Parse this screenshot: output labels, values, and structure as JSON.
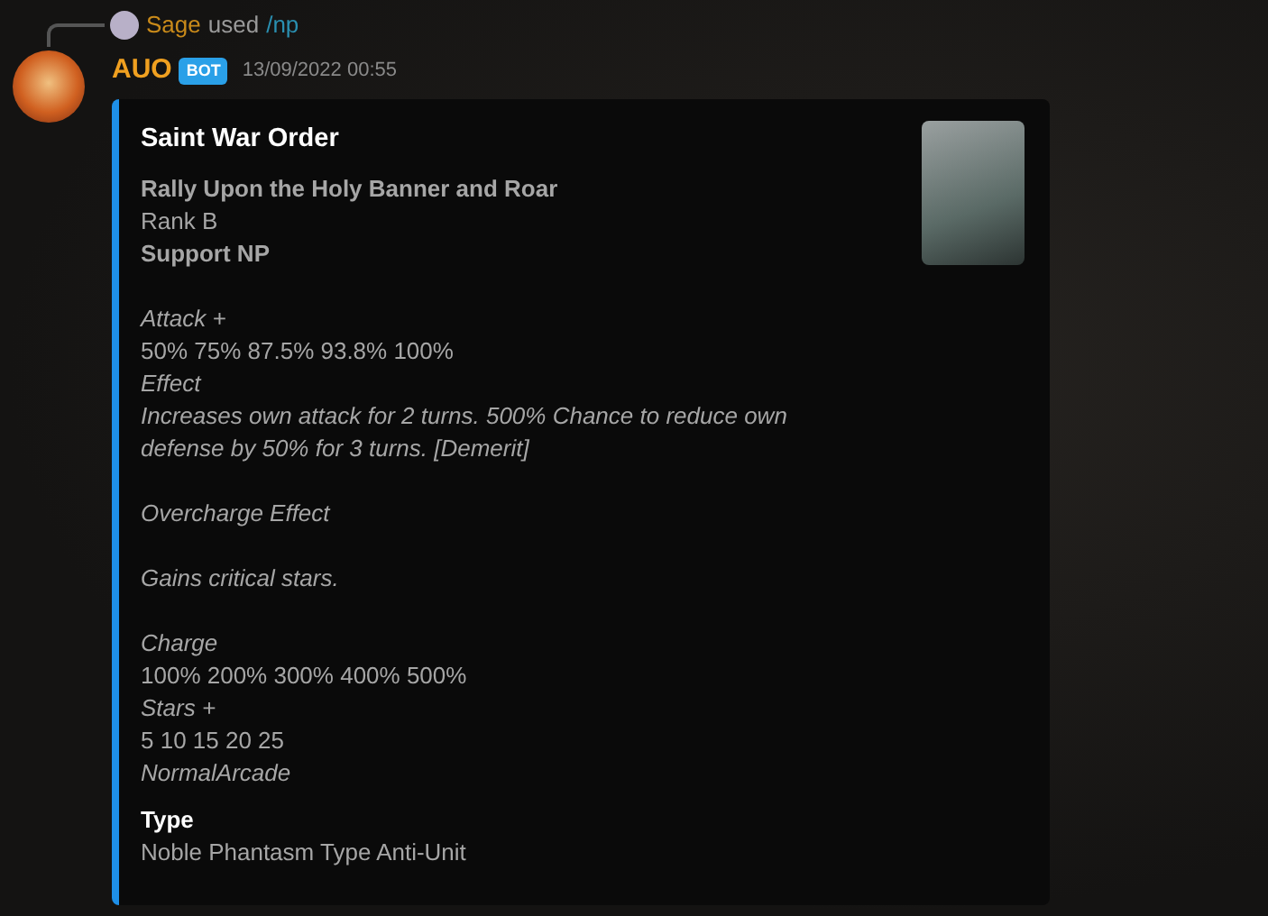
{
  "reply": {
    "user": "Sage",
    "verb": "used",
    "command": "/np"
  },
  "message": {
    "author": "AUO",
    "badge": "BOT",
    "timestamp": "13/09/2022 00:55"
  },
  "embed": {
    "title": "Saint War Order",
    "paragraphs": [
      {
        "lines": [
          {
            "kind": "bold",
            "text": "Rally Upon the Holy Banner and Roar"
          },
          {
            "kind": "plain",
            "text": "Rank B"
          },
          {
            "kind": "bold",
            "text": "Support NP"
          }
        ]
      },
      {
        "lines": [
          {
            "kind": "italic",
            "text": "Attack +"
          },
          {
            "kind": "plain",
            "text": "50% 75% 87.5% 93.8% 100%"
          },
          {
            "kind": "italic",
            "text": "Effect"
          },
          {
            "kind": "italic",
            "text": "Increases own attack for 2 turns. 500% Chance to reduce own defense by 50% for 3 turns. [Demerit]"
          }
        ]
      },
      {
        "lines": [
          {
            "kind": "italic",
            "text": "Overcharge Effect"
          }
        ]
      },
      {
        "lines": [
          {
            "kind": "italic",
            "text": "Gains critical stars."
          }
        ]
      },
      {
        "lines": [
          {
            "kind": "italic",
            "text": "Charge"
          },
          {
            "kind": "plain",
            "text": "100% 200% 300% 400% 500%"
          },
          {
            "kind": "italic",
            "text": "Stars +"
          },
          {
            "kind": "plain",
            "text": "5 10 15 20 25"
          },
          {
            "kind": "italic",
            "text": "NormalArcade"
          }
        ]
      }
    ],
    "field": {
      "name": "Type",
      "value": "Noble Phantasm Type Anti-Unit"
    }
  }
}
